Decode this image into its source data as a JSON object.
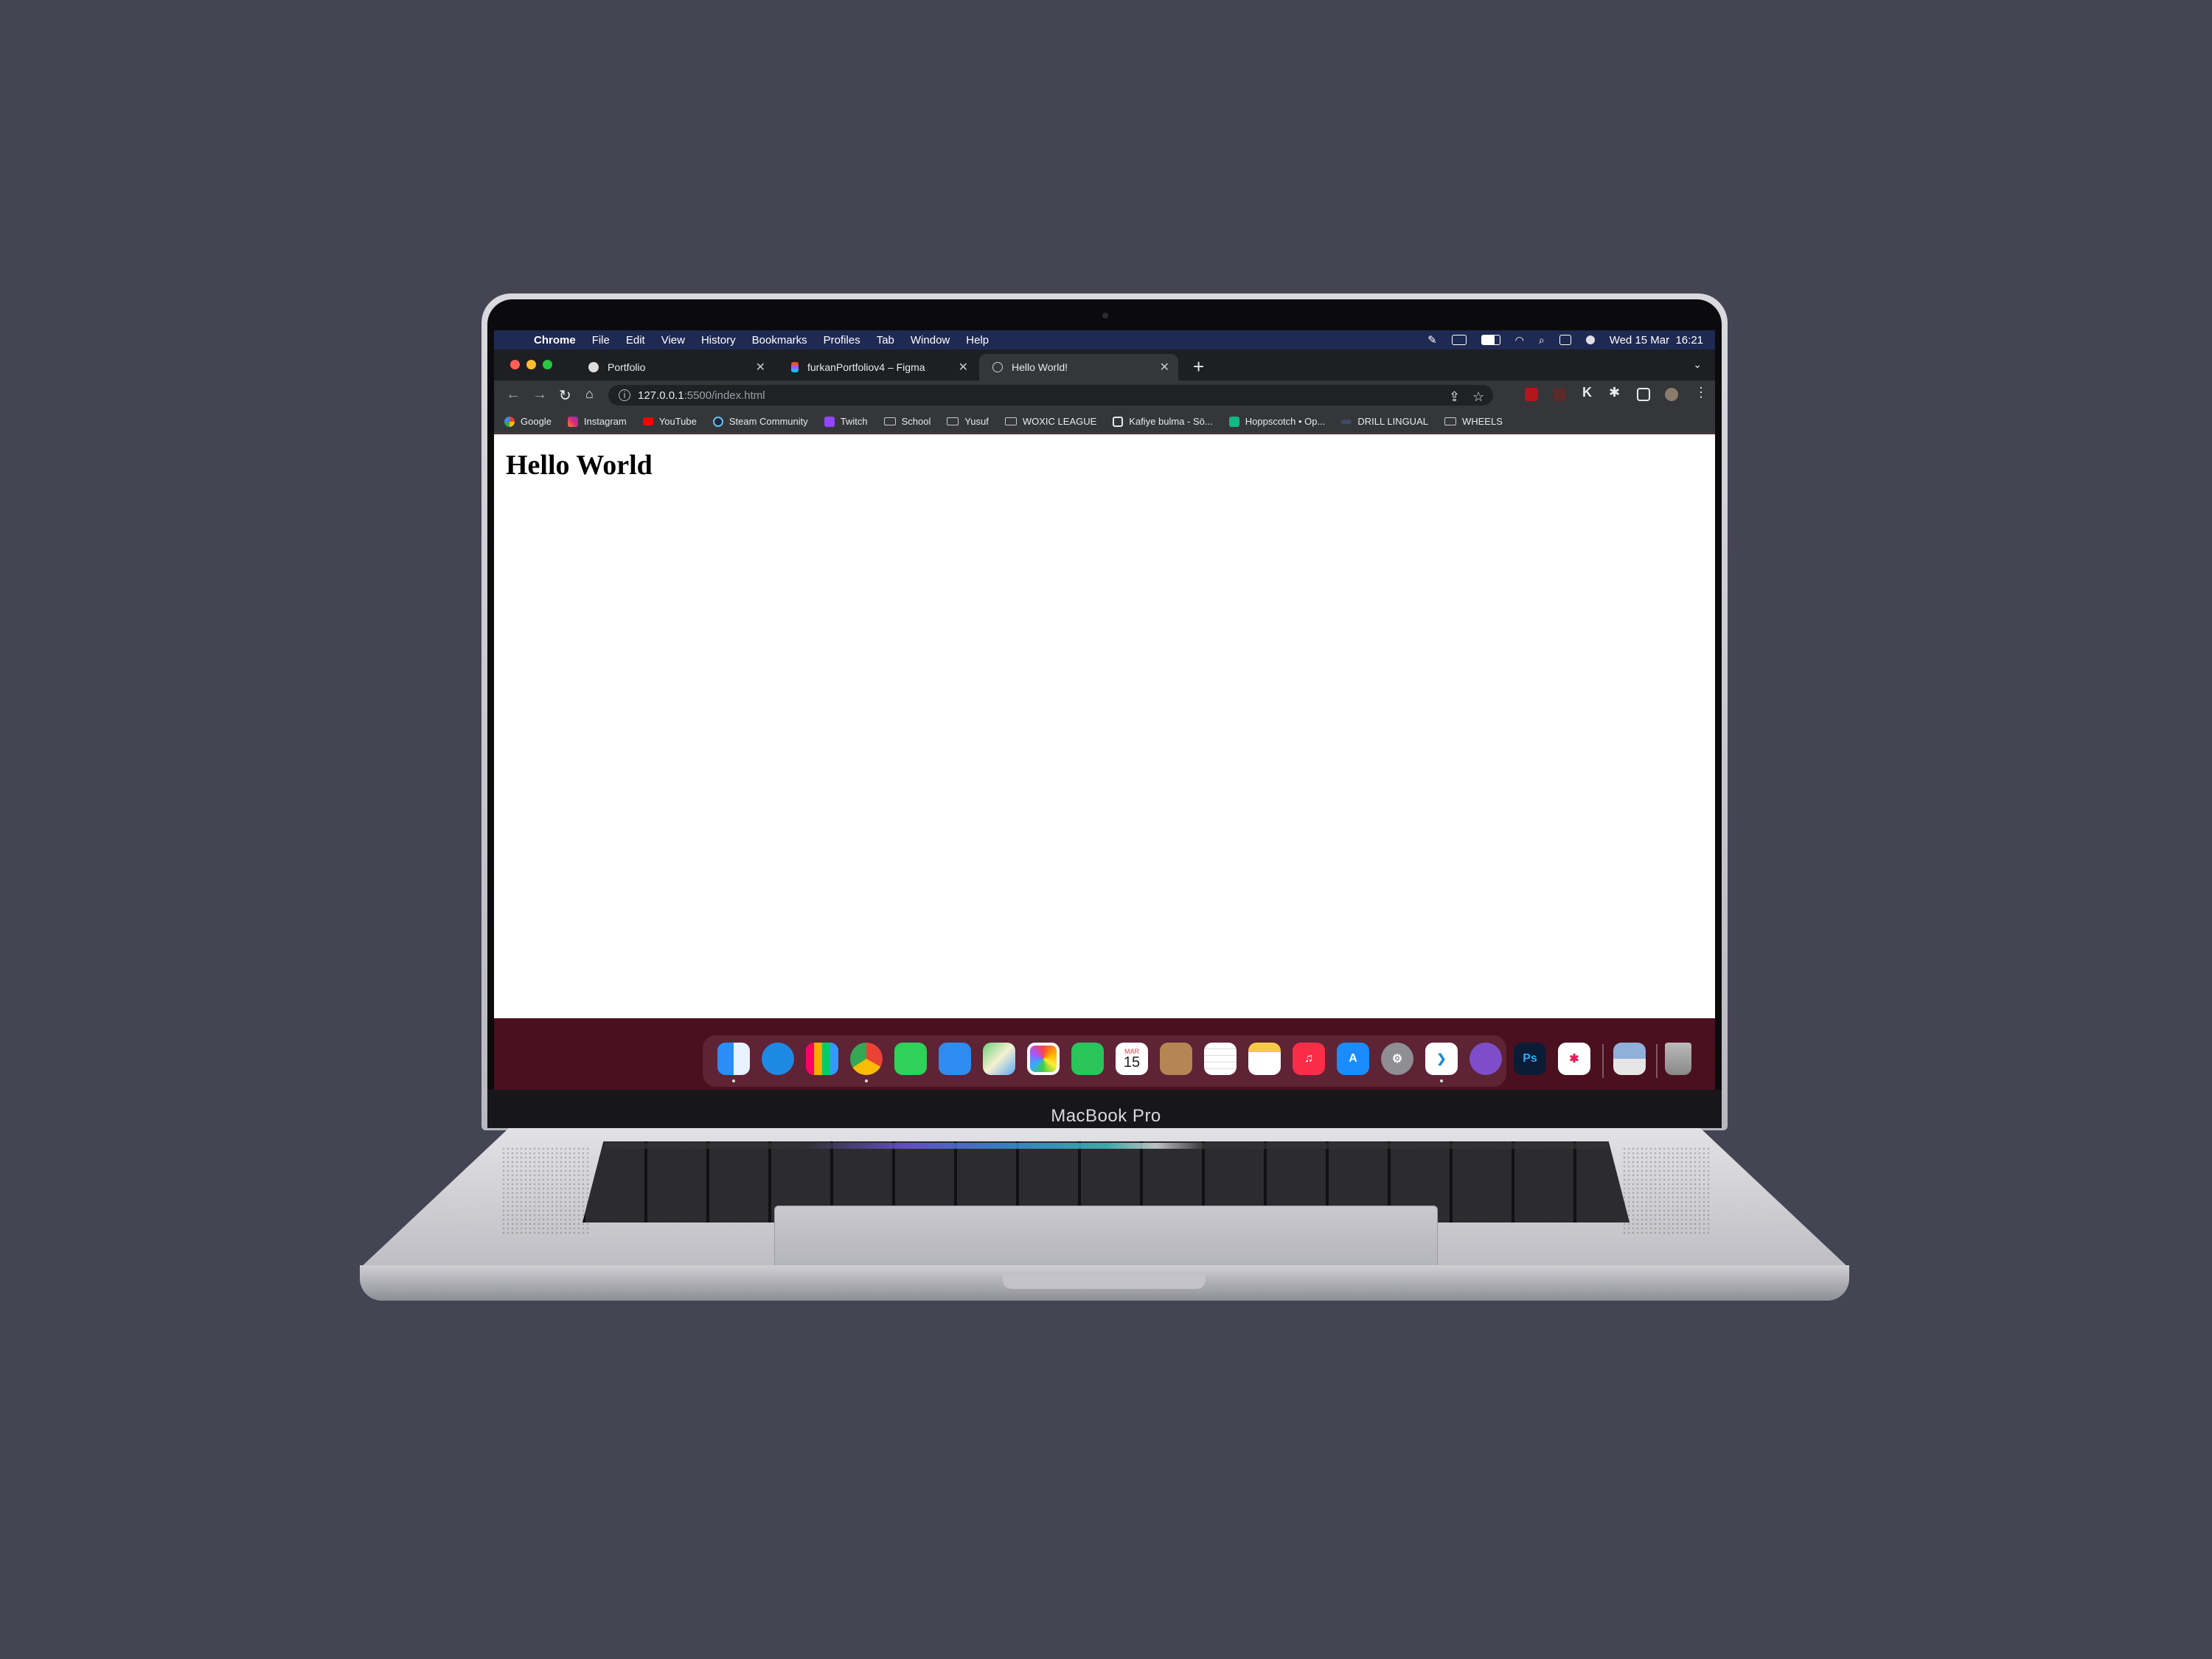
{
  "menubar": {
    "app": "Chrome",
    "items": [
      "File",
      "Edit",
      "View",
      "History",
      "Bookmarks",
      "Profiles",
      "Tab",
      "Window",
      "Help"
    ],
    "clock": "Wed 15 Mar  16:21"
  },
  "tabs": [
    {
      "title": "Portfolio",
      "active": false
    },
    {
      "title": "furkanPortfoliov4 – Figma",
      "active": false
    },
    {
      "title": "Hello World!",
      "active": true
    }
  ],
  "address": {
    "host": "127.0.0.1",
    "path": ":5500/index.html"
  },
  "bookmarks": [
    {
      "label": "Google",
      "icon": "google-icon"
    },
    {
      "label": "Instagram",
      "icon": "instagram-icon"
    },
    {
      "label": "YouTube",
      "icon": "youtube-icon"
    },
    {
      "label": "Steam Community",
      "icon": "steam-icon"
    },
    {
      "label": "Twitch",
      "icon": "twitch-icon"
    },
    {
      "label": "School",
      "icon": "folder-icon"
    },
    {
      "label": "Yusuf",
      "icon": "folder-icon"
    },
    {
      "label": "WOXIC LEAGUE",
      "icon": "folder-icon"
    },
    {
      "label": "Kafiye bulma - Sö...",
      "icon": "search-icon"
    },
    {
      "label": "Hoppscotch • Op...",
      "icon": "hoppscotch-icon"
    },
    {
      "label": "DRILL LINGUAL",
      "icon": "drill-icon"
    },
    {
      "label": "WHEELS",
      "icon": "folder-icon"
    }
  ],
  "page": {
    "heading": "Hello World"
  },
  "dock": {
    "calendar_month": "MAR",
    "calendar_day": "15",
    "ps_label": "Ps"
  },
  "device": {
    "brand": "MacBook Pro"
  },
  "colors": {
    "background": "#454453",
    "menubar": "#1f2a52",
    "tabstrip": "#1e1f22",
    "toolbar": "#35363a"
  }
}
